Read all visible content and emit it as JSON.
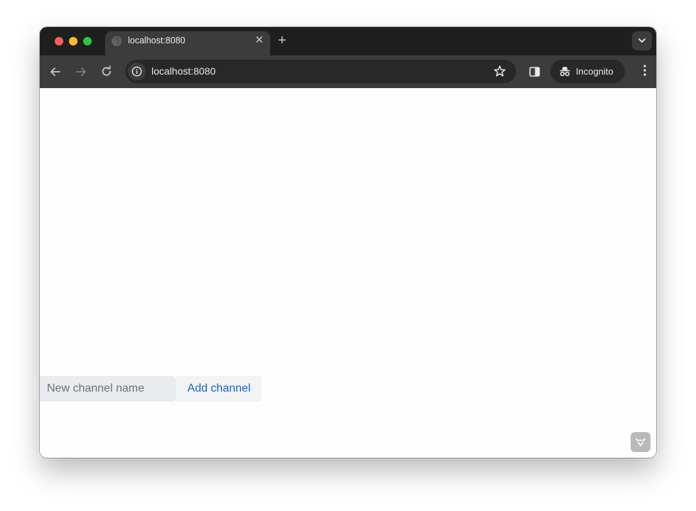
{
  "browser": {
    "tab": {
      "title": "localhost:8080",
      "favicon": "globe-icon",
      "close_icon": "close-icon"
    },
    "new_tab_icon": "plus-icon",
    "tab_search_icon": "chevron-down-icon",
    "toolbar": {
      "back_icon": "arrow-left-icon",
      "forward_icon": "arrow-right-icon",
      "reload_icon": "reload-icon",
      "site_info_icon": "info-icon",
      "url": "localhost:8080",
      "bookmark_icon": "star-icon",
      "side_panel_icon": "side-panel-icon",
      "incognito_label": "Incognito",
      "incognito_icon": "incognito-icon",
      "menu_icon": "more-vertical-icon"
    }
  },
  "page": {
    "channel_form": {
      "input_value": "",
      "input_placeholder": "New channel name",
      "add_button_label": "Add channel"
    },
    "devtools_badge_icon": "devtools-logo-icon"
  },
  "colors": {
    "accent": "#1a66c2",
    "input_bg": "#e9ebee",
    "button_bg": "#f1f3f5"
  }
}
